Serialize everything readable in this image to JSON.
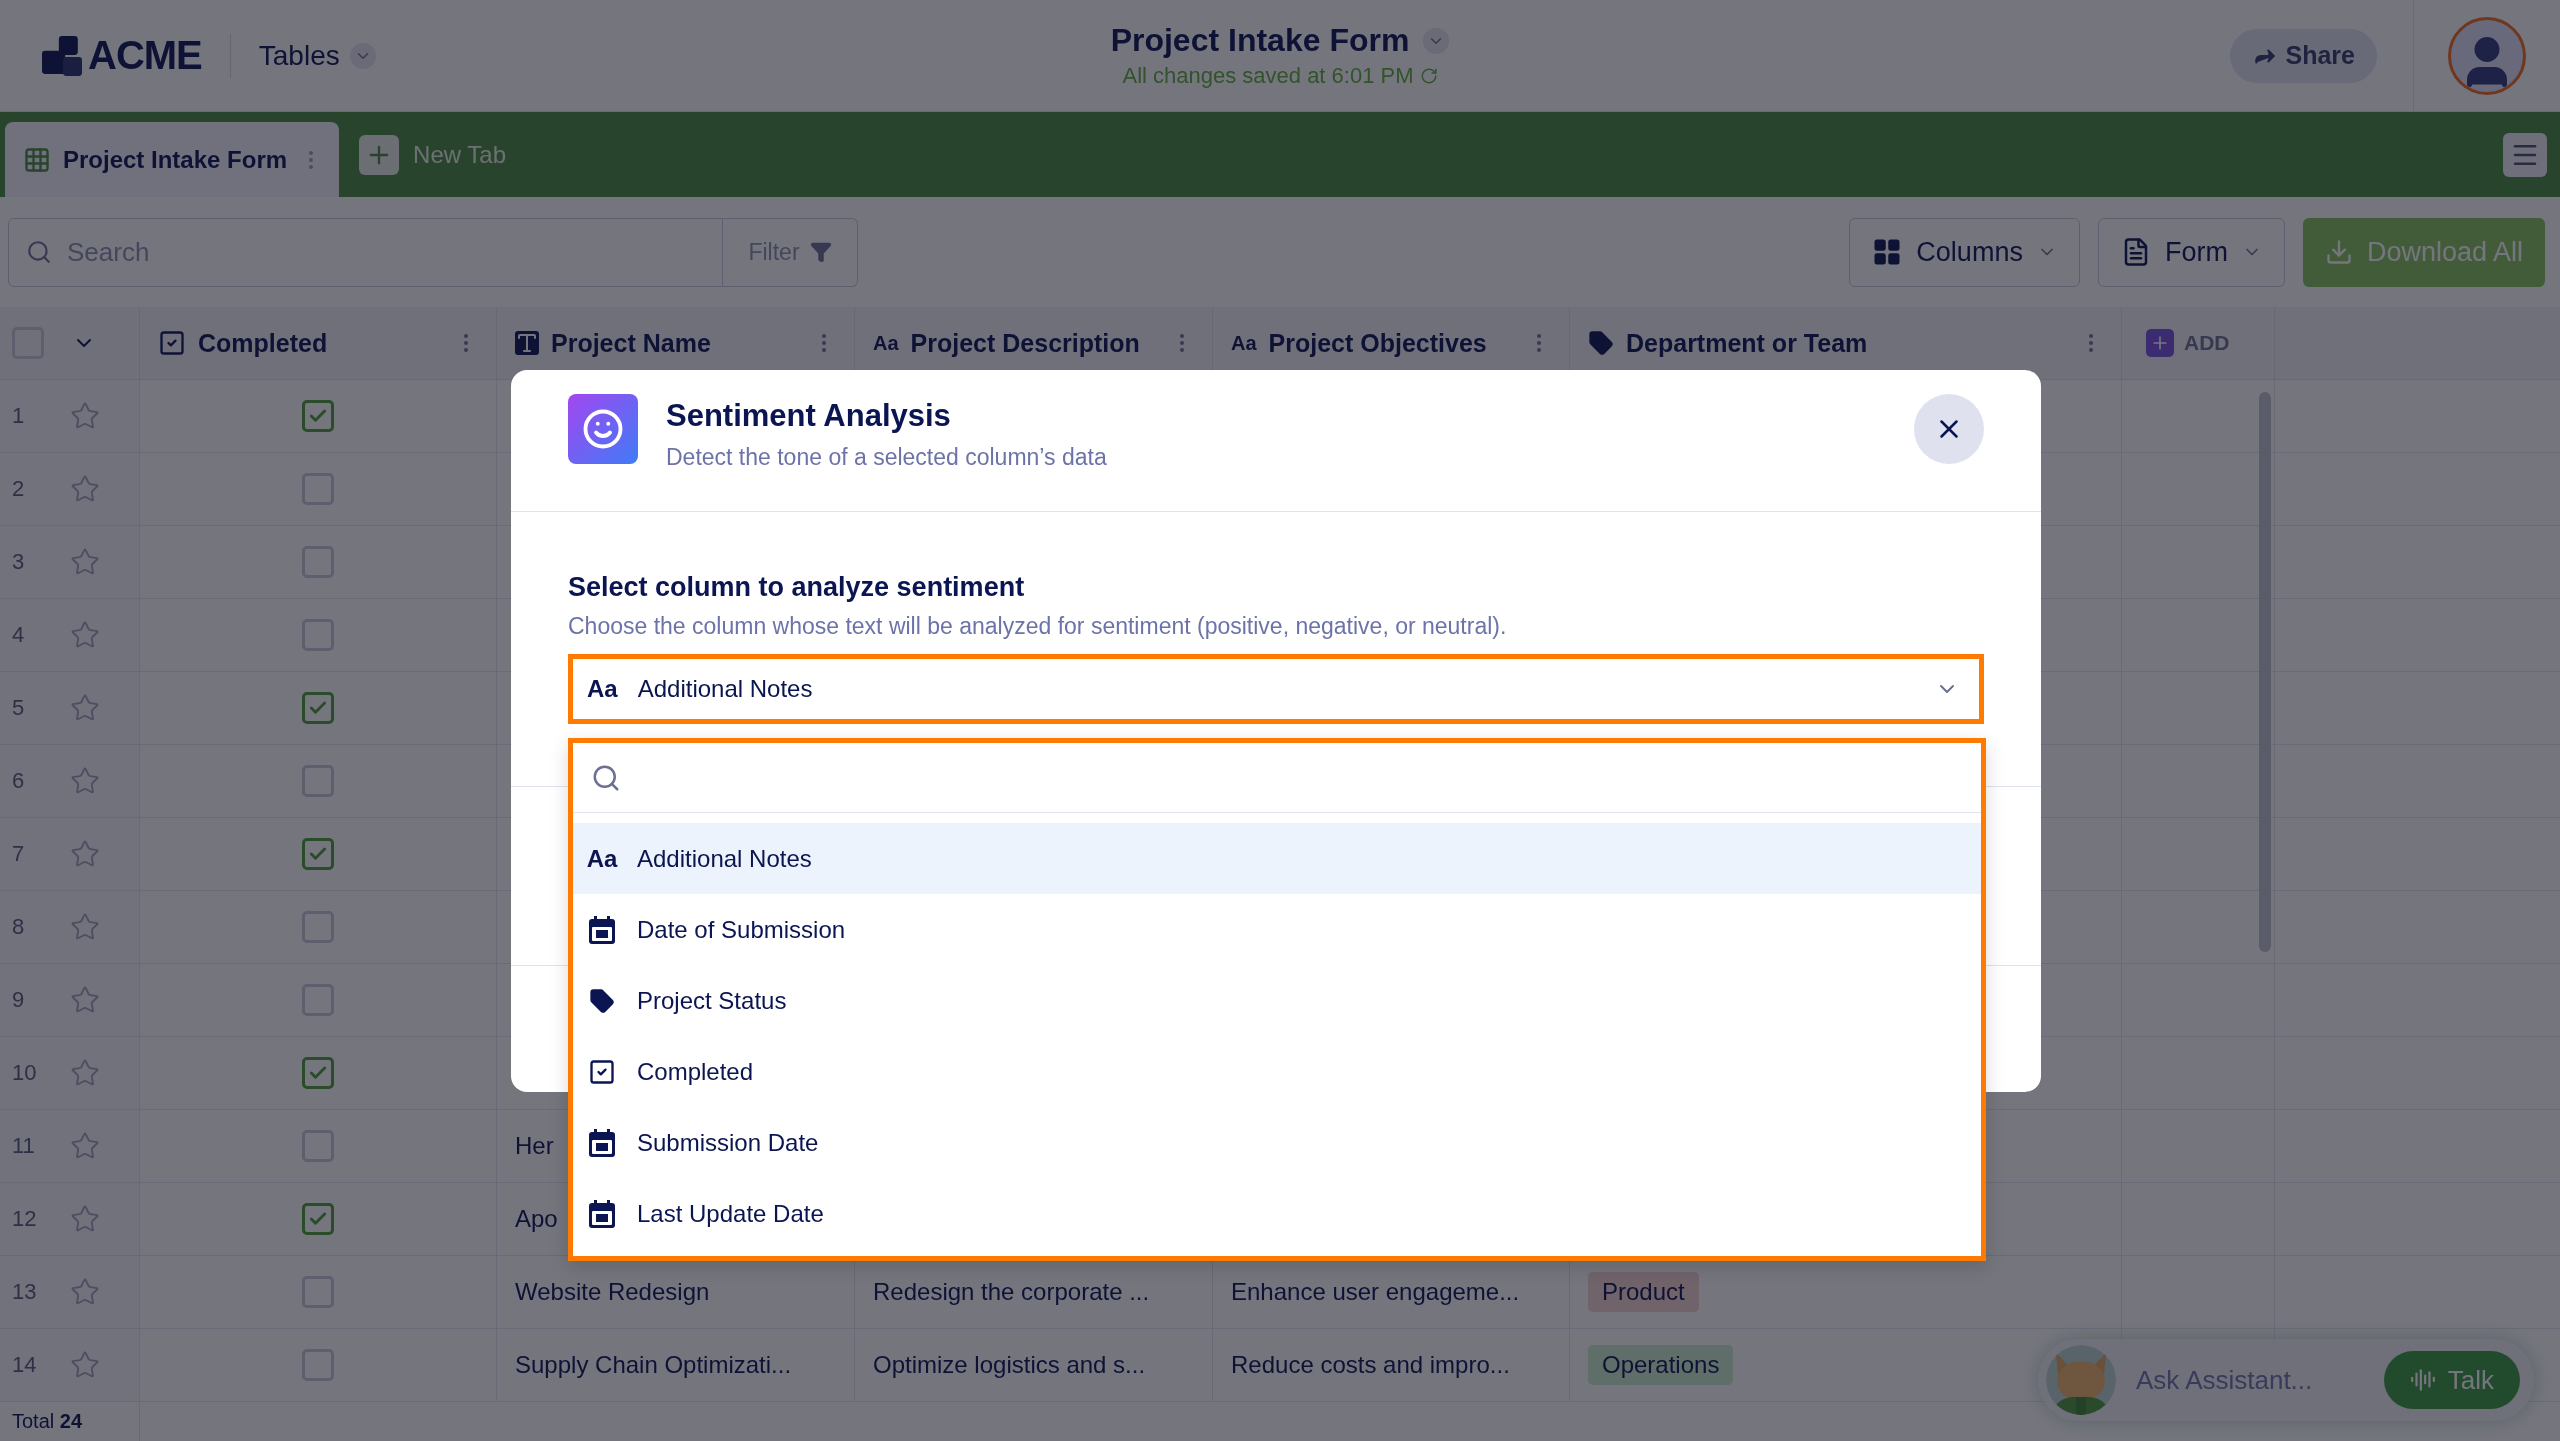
{
  "header": {
    "logo": "ACME",
    "menu": "Tables",
    "title": "Project Intake Form",
    "save_status": "All changes saved at 6:01 PM",
    "share": "Share"
  },
  "tabs": [
    {
      "label": "Project Intake Form",
      "selected": true
    }
  ],
  "new_tab": "New Tab",
  "toolbar": {
    "search_placeholder": "Search",
    "filter": "Filter",
    "columns": "Columns",
    "form": "Form",
    "download": "Download All"
  },
  "table": {
    "all_selected": false,
    "columns": [
      {
        "label": "Completed",
        "kind": "checkbox"
      },
      {
        "label": "Project Name",
        "kind": "title"
      },
      {
        "label": "Project Description",
        "kind": "text",
        "glyph": "Aa"
      },
      {
        "label": "Project Objectives",
        "kind": "text",
        "glyph": "Aa"
      },
      {
        "label": "Department or Team",
        "kind": "tag"
      }
    ],
    "add_column": "ADD",
    "rows": [
      {
        "number": "1",
        "completed": true
      },
      {
        "number": "2",
        "completed": false
      },
      {
        "number": "3",
        "completed": false
      },
      {
        "number": "4",
        "completed": false
      },
      {
        "number": "5",
        "completed": true
      },
      {
        "number": "6",
        "completed": false
      },
      {
        "number": "7",
        "completed": true
      },
      {
        "number": "8",
        "completed": false
      },
      {
        "number": "9",
        "completed": false
      },
      {
        "number": "10",
        "completed": true
      },
      {
        "number": "11",
        "completed": false,
        "name": "Her"
      },
      {
        "number": "12",
        "completed": true,
        "name": "Apo"
      },
      {
        "number": "13",
        "completed": false,
        "name": "Website Redesign",
        "description": "Redesign the corporate ...",
        "objectives": "Enhance user engageme...",
        "department": {
          "label": "Product",
          "color": "#71636a"
        }
      },
      {
        "number": "14",
        "completed": false,
        "name": "Supply Chain Optimizati...",
        "description": "Optimize logistics and s...",
        "objectives": "Reduce costs and impro...",
        "department": {
          "label": "Operations",
          "color": "#5f6e69"
        }
      }
    ],
    "total": "Total **24**"
  },
  "modal": {
    "title": "Sentiment Analysis",
    "subtitle": "Detect the tone of a selected column’s data",
    "field_label": "Select column to analyze sentiment",
    "field_hint": "Choose the column whose text will be analyzed for sentiment (positive, negative, or neutral).",
    "select": {
      "kind": "text",
      "glyph": "Aa",
      "value": "Additional Notes",
      "expanded": true
    }
  },
  "dropdown": {
    "options": [
      {
        "kind": "text",
        "glyph": "Aa",
        "label": "Additional Notes",
        "selected": true
      },
      {
        "kind": "date",
        "label": "Date of Submission",
        "selected": false
      },
      {
        "kind": "tag",
        "label": "Project Status",
        "selected": false
      },
      {
        "kind": "checkbox",
        "label": "Completed",
        "selected": false
      },
      {
        "kind": "date",
        "label": "Submission Date",
        "selected": false
      },
      {
        "kind": "date",
        "label": "Last Update Date",
        "selected": false
      }
    ]
  },
  "assistant": {
    "placeholder": "Ask Assistant...",
    "talk": "Talk"
  }
}
